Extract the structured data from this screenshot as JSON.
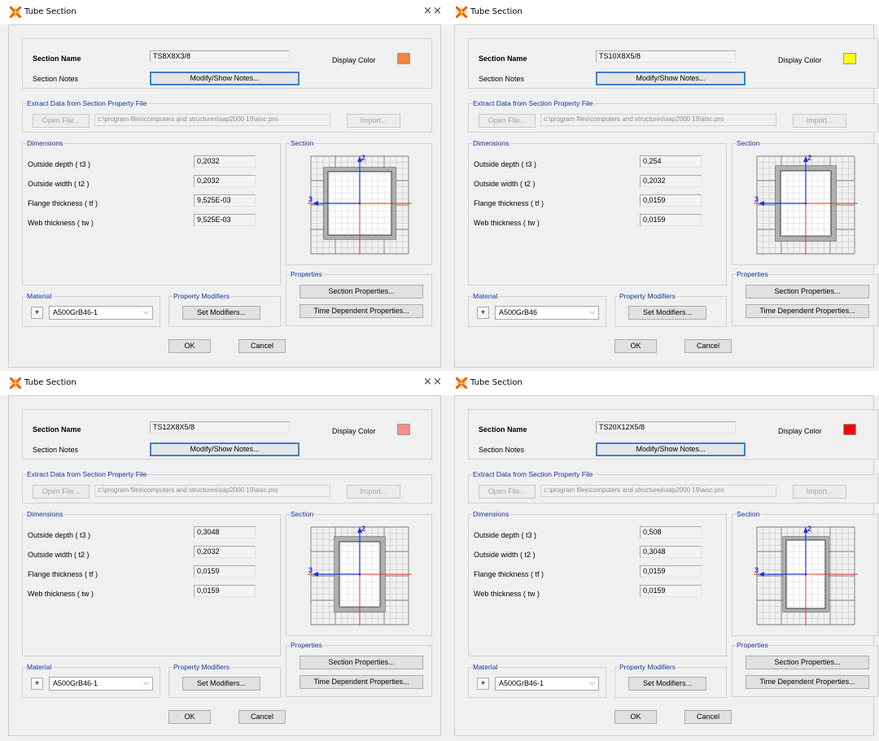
{
  "ui": {
    "window_title": "Tube Section",
    "close_glyph": "×",
    "section_name_label": "Section Name",
    "section_notes_label": "Section Notes",
    "modify_notes_label": "Modify/Show Notes...",
    "display_color_label": "Display Color",
    "extract_group_label": "Extract Data from Section Property File",
    "open_file_label": "Open File...",
    "file_path": "c:\\program files\\computers and structures\\sap2000 19\\aisc.pro",
    "import_label": "Import...",
    "dimensions_label": "Dimensions",
    "outside_depth_label": "Outside depth  ( t3 )",
    "outside_width_label": "Outside width  ( t2 )",
    "flange_thickness_label": "Flange thickness  ( tf )",
    "web_thickness_label": "Web thickness  ( tw )",
    "section_group_label": "Section",
    "axis_2": "2",
    "axis_3": "3",
    "properties_label": "Properties",
    "section_properties_label": "Section Properties...",
    "time_dependent_label": "Time Dependent Properties...",
    "material_label": "Material",
    "plus_label": "+",
    "dropdown_arrow": "⌵",
    "property_modifiers_label": "Property Modifiers",
    "set_modifiers_label": "Set Modifiers...",
    "ok_label": "OK",
    "cancel_label": "Cancel"
  },
  "dialogs": [
    {
      "section_name": "TS8X8X3/8",
      "display_color": "#f7853f",
      "outside_depth": "0,2032",
      "outside_width": "0,2032",
      "flange_thickness": "9,525E-03",
      "web_thickness": "9,525E-03",
      "material": "A500GrB46-1",
      "notes_focused": true
    },
    {
      "section_name": "TS10X8X5/8",
      "display_color": "#ffff00",
      "outside_depth": "0,254",
      "outside_width": "0,2032",
      "flange_thickness": "0,0159",
      "web_thickness": "0,0159",
      "material": "A500GrB46",
      "notes_focused": true
    },
    {
      "section_name": "TS12X8X5/8",
      "display_color": "#fc8d8d",
      "outside_depth": "0,3048",
      "outside_width": "0,2032",
      "flange_thickness": "0,0159",
      "web_thickness": "0,0159",
      "material": "A500GrB46-1",
      "notes_focused": true
    },
    {
      "section_name": "TS20X12X5/8",
      "display_color": "#ff0000",
      "outside_depth": "0,508",
      "outside_width": "0,3048",
      "flange_thickness": "0,0159",
      "web_thickness": "0,0159",
      "material": "A500GrB46-1",
      "notes_focused": true
    }
  ],
  "icons": {
    "app_icon": "sap2000-app-icon",
    "close": "close-icon"
  },
  "colors": {
    "group_legend": "#1c2f9a",
    "axis_2": "#2030d8",
    "axis_3_line": "#e03030",
    "focus_border": "#3c7fd4"
  }
}
